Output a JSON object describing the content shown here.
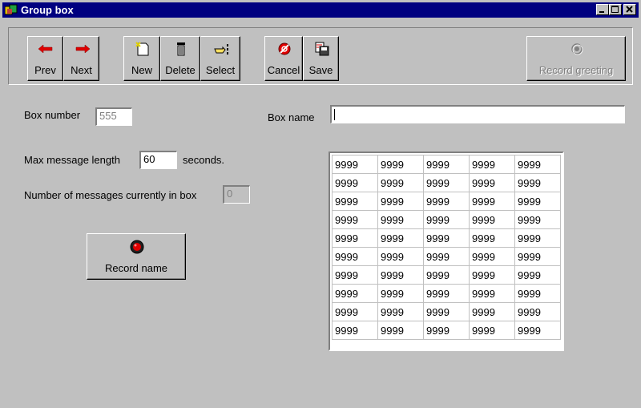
{
  "window": {
    "title": "Group box",
    "title_color": "#000080"
  },
  "toolbar": {
    "buttons": [
      {
        "key": "prev",
        "label": "Prev",
        "icon": "arrow-left-icon"
      },
      {
        "key": "next",
        "label": "Next",
        "icon": "arrow-right-icon"
      },
      {
        "key": "new",
        "label": "New",
        "icon": "new-document-icon"
      },
      {
        "key": "delete",
        "label": "Delete",
        "icon": "trash-icon"
      },
      {
        "key": "select",
        "label": "Select",
        "icon": "pointing-hand-icon"
      },
      {
        "key": "cancel",
        "label": "Cancel",
        "icon": "cancel-icon"
      },
      {
        "key": "save",
        "label": "Save",
        "icon": "save-icon"
      },
      {
        "key": "record_greeting",
        "label": "Record greeting",
        "icon": "record-icon",
        "disabled": true
      }
    ]
  },
  "form": {
    "box_number_label": "Box number",
    "box_number_value": "555",
    "box_name_label": "Box name",
    "box_name_value": "",
    "max_length_label": "Max message length",
    "max_length_value": "60",
    "max_length_unit": "seconds.",
    "num_messages_label": "Number of messages currently in box",
    "num_messages_value": "0",
    "record_name_label": "Record name"
  },
  "grid": {
    "rows": [
      [
        "9999",
        "9999",
        "9999",
        "9999",
        "9999"
      ],
      [
        "9999",
        "9999",
        "9999",
        "9999",
        "9999"
      ],
      [
        "9999",
        "9999",
        "9999",
        "9999",
        "9999"
      ],
      [
        "9999",
        "9999",
        "9999",
        "9999",
        "9999"
      ],
      [
        "9999",
        "9999",
        "9999",
        "9999",
        "9999"
      ],
      [
        "9999",
        "9999",
        "9999",
        "9999",
        "9999"
      ],
      [
        "9999",
        "9999",
        "9999",
        "9999",
        "9999"
      ],
      [
        "9999",
        "9999",
        "9999",
        "9999",
        "9999"
      ],
      [
        "9999",
        "9999",
        "9999",
        "9999",
        "9999"
      ],
      [
        "9999",
        "9999",
        "9999",
        "9999",
        "9999"
      ]
    ]
  }
}
